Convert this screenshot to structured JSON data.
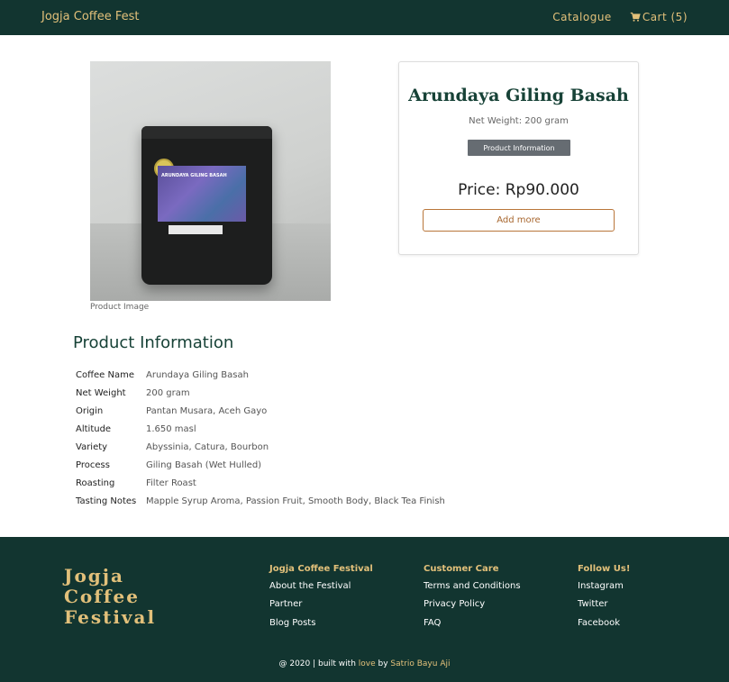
{
  "navbar": {
    "brand": "Jogja Coffee Fest",
    "catalogue": "Catalogue",
    "cart": "Cart (5)"
  },
  "product": {
    "image_caption": "Product Image",
    "bag_label": "ARUNDAYA GILING BASAH",
    "title": "Arundaya Giling Basah",
    "net_weight": "Net Weight: 200 gram",
    "info_button": "Product Information",
    "price": "Price: Rp90.000",
    "add_button": "Add more"
  },
  "info": {
    "heading": "Product Information",
    "rows": [
      {
        "key": "Coffee Name",
        "value": "Arundaya Giling Basah"
      },
      {
        "key": "Net Weight",
        "value": "200 gram"
      },
      {
        "key": "Origin",
        "value": "Pantan Musara, Aceh Gayo"
      },
      {
        "key": "Altitude",
        "value": "1.650 masl"
      },
      {
        "key": "Variety",
        "value": "Abyssinia, Catura, Bourbon"
      },
      {
        "key": "Process",
        "value": "Giling Basah (Wet Hulled)"
      },
      {
        "key": "Roasting",
        "value": "Filter Roast"
      },
      {
        "key": "Tasting Notes",
        "value": "Mapple Syrup Aroma, Passion Fruit, Smooth Body, Black Tea Finish"
      }
    ]
  },
  "footer": {
    "logo_lines": [
      "Jogja",
      "Coffee",
      "Festival"
    ],
    "columns": [
      {
        "heading": "Jogja Coffee Festival",
        "links": [
          "About the Festival",
          "Partner",
          "Blog Posts"
        ]
      },
      {
        "heading": "Customer Care",
        "links": [
          "Terms and Conditions",
          "Privacy Policy",
          "FAQ"
        ]
      },
      {
        "heading": "Follow Us!",
        "links": [
          "Instagram",
          "Twitter",
          "Facebook"
        ]
      }
    ],
    "copyright_prefix": "@ 2020 | built with ",
    "love": "love",
    "by": " by ",
    "author": "Satrio Bayu Aji"
  },
  "colors": {
    "navbar_bg": "#123530",
    "accent_gold": "#e2c07a",
    "title_green": "#174237",
    "button_gray": "#666c72",
    "add_border": "#b9763a"
  },
  "icons": {
    "cart": "cart-icon"
  }
}
